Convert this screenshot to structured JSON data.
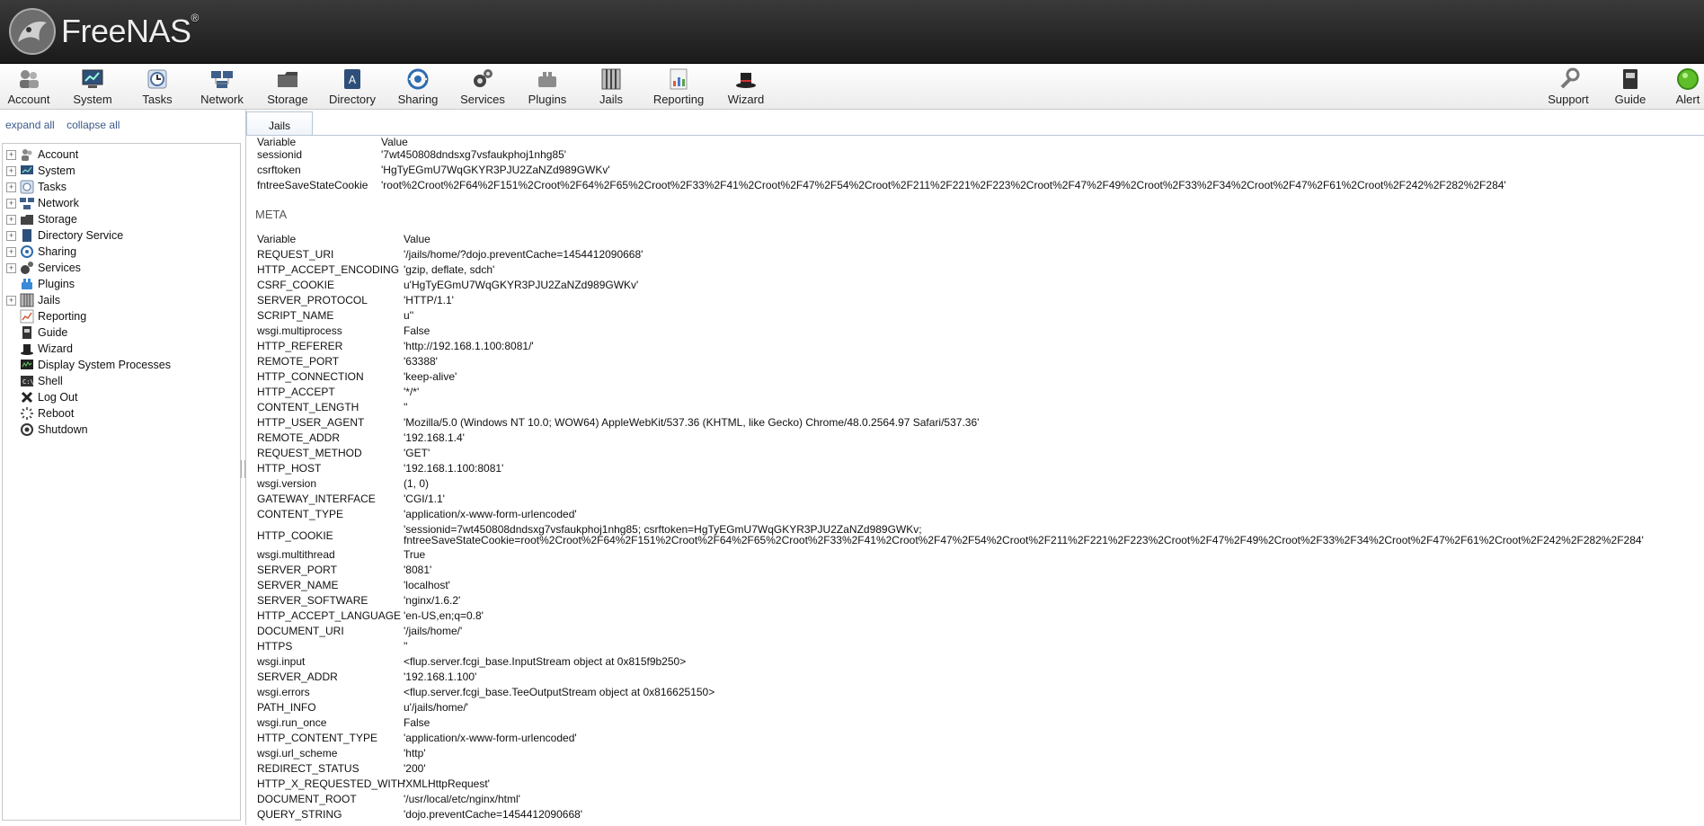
{
  "app": {
    "name": "FreeNAS",
    "reg": "®"
  },
  "toolbar": {
    "left": [
      {
        "label": "Account",
        "icon": "account-icon"
      },
      {
        "label": "System",
        "icon": "system-icon"
      },
      {
        "label": "Tasks",
        "icon": "tasks-icon"
      },
      {
        "label": "Network",
        "icon": "network-icon"
      },
      {
        "label": "Storage",
        "icon": "storage-icon"
      },
      {
        "label": "Directory",
        "icon": "directory-icon"
      },
      {
        "label": "Sharing",
        "icon": "sharing-icon"
      },
      {
        "label": "Services",
        "icon": "services-icon"
      },
      {
        "label": "Plugins",
        "icon": "plugins-icon"
      },
      {
        "label": "Jails",
        "icon": "jails-icon"
      },
      {
        "label": "Reporting",
        "icon": "reporting-icon"
      },
      {
        "label": "Wizard",
        "icon": "wizard-icon"
      }
    ],
    "right": [
      {
        "label": "Support",
        "icon": "support-icon"
      },
      {
        "label": "Guide",
        "icon": "guide-icon"
      },
      {
        "label": "Alert",
        "icon": "alert-icon"
      }
    ]
  },
  "tree_controls": {
    "expand": "expand all",
    "collapse": "collapse all"
  },
  "tree": [
    {
      "label": "Account",
      "expandable": true,
      "icon": "account-icon"
    },
    {
      "label": "System",
      "expandable": true,
      "icon": "system-icon"
    },
    {
      "label": "Tasks",
      "expandable": true,
      "icon": "tasks-icon"
    },
    {
      "label": "Network",
      "expandable": true,
      "icon": "network-icon"
    },
    {
      "label": "Storage",
      "expandable": true,
      "icon": "storage-icon"
    },
    {
      "label": "Directory Service",
      "expandable": true,
      "icon": "directory-icon"
    },
    {
      "label": "Sharing",
      "expandable": true,
      "icon": "sharing-icon"
    },
    {
      "label": "Services",
      "expandable": true,
      "icon": "services-icon"
    },
    {
      "label": "Plugins",
      "expandable": false,
      "icon": "plugins-icon"
    },
    {
      "label": "Jails",
      "expandable": true,
      "icon": "jails-icon"
    },
    {
      "label": "Reporting",
      "expandable": false,
      "icon": "reporting-icon"
    },
    {
      "label": "Guide",
      "expandable": false,
      "icon": "guide-icon"
    },
    {
      "label": "Wizard",
      "expandable": false,
      "icon": "wizard-icon"
    },
    {
      "label": "Display System Processes",
      "expandable": false,
      "icon": "processes-icon"
    },
    {
      "label": "Shell",
      "expandable": false,
      "icon": "shell-icon"
    },
    {
      "label": "Log Out",
      "expandable": false,
      "icon": "logout-icon"
    },
    {
      "label": "Reboot",
      "expandable": false,
      "icon": "reboot-icon"
    },
    {
      "label": "Shutdown",
      "expandable": false,
      "icon": "shutdown-icon"
    }
  ],
  "tab": {
    "label": "Jails"
  },
  "cookies": {
    "header": {
      "variable": "Variable",
      "value": "Value"
    },
    "rows": [
      {
        "k": "sessionid",
        "v": "'7wt450808dndsxg7vsfaukphoj1nhg85'"
      },
      {
        "k": "csrftoken",
        "v": "'HgTyEGmU7WqGKYR3PJU2ZaNZd989GWKv'"
      },
      {
        "k": "fntreeSaveStateCookie",
        "v": "'root%2Croot%2F64%2F151%2Croot%2F64%2F65%2Croot%2F33%2F41%2Croot%2F47%2F54%2Croot%2F211%2F221%2F223%2Croot%2F47%2F49%2Croot%2F33%2F34%2Croot%2F47%2F61%2Croot%2F242%2F282%2F284'"
      }
    ]
  },
  "meta": {
    "title": "META",
    "header": {
      "variable": "Variable",
      "value": "Value"
    },
    "rows": [
      {
        "k": "REQUEST_URI",
        "v": "'/jails/home/?dojo.preventCache=1454412090668'"
      },
      {
        "k": "HTTP_ACCEPT_ENCODING",
        "v": "'gzip, deflate, sdch'"
      },
      {
        "k": "CSRF_COOKIE",
        "v": "u'HgTyEGmU7WqGKYR3PJU2ZaNZd989GWKv'"
      },
      {
        "k": "SERVER_PROTOCOL",
        "v": "'HTTP/1.1'"
      },
      {
        "k": "SCRIPT_NAME",
        "v": "u''"
      },
      {
        "k": "wsgi.multiprocess",
        "v": "False"
      },
      {
        "k": "HTTP_REFERER",
        "v": "'http://192.168.1.100:8081/'"
      },
      {
        "k": "REMOTE_PORT",
        "v": "'63388'"
      },
      {
        "k": "HTTP_CONNECTION",
        "v": "'keep-alive'"
      },
      {
        "k": "HTTP_ACCEPT",
        "v": "'*/*'"
      },
      {
        "k": "CONTENT_LENGTH",
        "v": "''"
      },
      {
        "k": "HTTP_USER_AGENT",
        "v": "'Mozilla/5.0 (Windows NT 10.0; WOW64) AppleWebKit/537.36 (KHTML, like Gecko) Chrome/48.0.2564.97 Safari/537.36'"
      },
      {
        "k": "REMOTE_ADDR",
        "v": "'192.168.1.4'"
      },
      {
        "k": "REQUEST_METHOD",
        "v": "'GET'"
      },
      {
        "k": "HTTP_HOST",
        "v": "'192.168.1.100:8081'"
      },
      {
        "k": "wsgi.version",
        "v": "(1, 0)"
      },
      {
        "k": "GATEWAY_INTERFACE",
        "v": "'CGI/1.1'"
      },
      {
        "k": "CONTENT_TYPE",
        "v": "'application/x-www-form-urlencoded'"
      },
      {
        "k": "HTTP_COOKIE",
        "v": "'sessionid=7wt450808dndsxg7vsfaukphoj1nhg85; csrftoken=HgTyEGmU7WqGKYR3PJU2ZaNZd989GWKv;",
        "v2": "fntreeSaveStateCookie=root%2Croot%2F64%2F151%2Croot%2F64%2F65%2Croot%2F33%2F41%2Croot%2F47%2F54%2Croot%2F211%2F221%2F223%2Croot%2F47%2F49%2Croot%2F33%2F34%2Croot%2F47%2F61%2Croot%2F242%2F282%2F284'"
      },
      {
        "k": "wsgi.multithread",
        "v": "True"
      },
      {
        "k": "SERVER_PORT",
        "v": "'8081'"
      },
      {
        "k": "SERVER_NAME",
        "v": "'localhost'"
      },
      {
        "k": "SERVER_SOFTWARE",
        "v": "'nginx/1.6.2'"
      },
      {
        "k": "HTTP_ACCEPT_LANGUAGE",
        "v": "'en-US,en;q=0.8'"
      },
      {
        "k": "DOCUMENT_URI",
        "v": "'/jails/home/'"
      },
      {
        "k": "HTTPS",
        "v": "''"
      },
      {
        "k": "wsgi.input",
        "v": "<flup.server.fcgi_base.InputStream object at 0x815f9b250>"
      },
      {
        "k": "SERVER_ADDR",
        "v": "'192.168.1.100'"
      },
      {
        "k": "wsgi.errors",
        "v": "<flup.server.fcgi_base.TeeOutputStream object at 0x816625150>"
      },
      {
        "k": "PATH_INFO",
        "v": "u'/jails/home/'"
      },
      {
        "k": "wsgi.run_once",
        "v": "False"
      },
      {
        "k": "HTTP_CONTENT_TYPE",
        "v": "'application/x-www-form-urlencoded'"
      },
      {
        "k": "wsgi.url_scheme",
        "v": "'http'"
      },
      {
        "k": "REDIRECT_STATUS",
        "v": "'200'"
      },
      {
        "k": "HTTP_X_REQUESTED_WITH",
        "v": "'XMLHttpRequest'"
      },
      {
        "k": "DOCUMENT_ROOT",
        "v": "'/usr/local/etc/nginx/html'"
      },
      {
        "k": "QUERY_STRING",
        "v": "'dojo.preventCache=1454412090668'"
      }
    ]
  }
}
